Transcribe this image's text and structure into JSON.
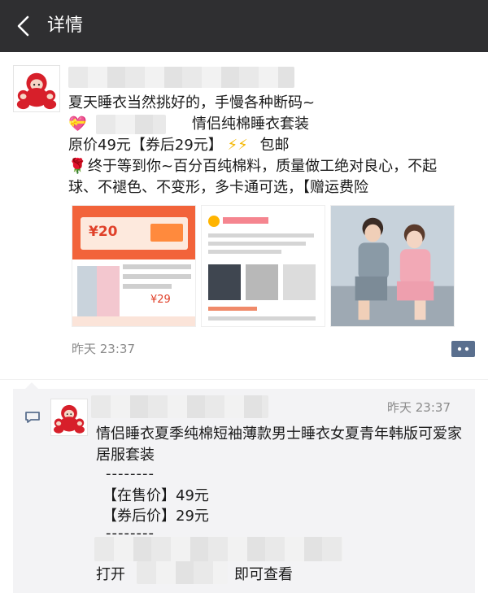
{
  "nav": {
    "title": "详情",
    "back_icon": "chevron-left-icon",
    "background": "#2f2f31"
  },
  "post": {
    "time": "昨天 23:37",
    "lines": {
      "l1": "夏天睡衣当然挑好的，手慢各种断码~",
      "l2_suffix": "情侣纯棉睡衣套装",
      "l3_prefix": "原价49元【券后29元】",
      "l3_suffix": "包邮",
      "l4": "终于等到你~百分百纯棉料，质量做工绝对良心，不起",
      "l5": "球、不褪色、不变形，多卡通可选，【赠运费险"
    },
    "emojis": {
      "heart": "💝",
      "bolt": "⚡⚡",
      "rose": "🌹"
    },
    "thumbnails": [
      {
        "coupon_amount": "¥20",
        "price": "¥29"
      },
      {
        "label": ""
      },
      {
        "label": ""
      }
    ]
  },
  "comment": {
    "time": "昨天 23:37",
    "text": "情侣睡衣夏季纯棉短袖薄款男士睡衣女夏青年韩版可爱家居服套装",
    "dash": "--------",
    "on_sale_label": "【在售价】49元",
    "after_coupon_label": "【券后价】29元",
    "open_prefix": "打开",
    "open_suffix": "即可查看"
  },
  "colors": {
    "accent_link": "#576b95",
    "timestamp": "#8a8a8a",
    "comment_bg": "#f3f3f5"
  }
}
